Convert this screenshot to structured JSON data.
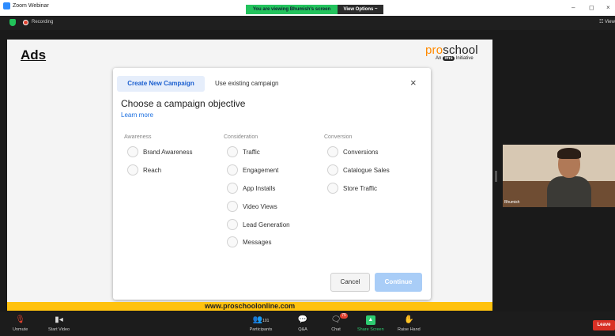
{
  "window": {
    "title": "Zoom Webinar",
    "share_banner": "You are viewing Bhumish's screen",
    "view_options": "View Options ~",
    "minimize": "–",
    "restore": "◻",
    "close": "×"
  },
  "meeting": {
    "recording_label": "Recording",
    "view_label": "☷ View"
  },
  "slide": {
    "title": "Ads",
    "brand_pro": "pro",
    "brand_rest": "school",
    "brand_sub_prefix": "An",
    "brand_sub_logo": "ims",
    "brand_sub_suffix": "Initiative",
    "footer_url": "www.proschoolonline.com"
  },
  "modal": {
    "tab_active": "Create New Campaign",
    "tab_other": "Use existing campaign",
    "close_glyph": "×",
    "heading": "Choose a campaign objective",
    "learn_more": "Learn more",
    "columns": [
      {
        "header": "Awareness",
        "options": [
          "Brand Awareness",
          "Reach"
        ]
      },
      {
        "header": "Consideration",
        "options": [
          "Traffic",
          "Engagement",
          "App Installs",
          "Video Views",
          "Lead Generation",
          "Messages"
        ]
      },
      {
        "header": "Conversion",
        "options": [
          "Conversions",
          "Catalogue Sales",
          "Store Traffic"
        ]
      }
    ],
    "cancel": "Cancel",
    "continue": "Continue"
  },
  "participant": {
    "name": "Bhumish"
  },
  "toolbar": {
    "items": [
      {
        "label": "Unmute",
        "icon": "microphone-muted-icon"
      },
      {
        "label": "Start Video",
        "icon": "video-off-icon"
      },
      {
        "label": "Participants",
        "icon": "participants-icon",
        "count": "101"
      },
      {
        "label": "Q&A",
        "icon": "qa-icon"
      },
      {
        "label": "Chat",
        "icon": "chat-icon",
        "badge": "75"
      },
      {
        "label": "Share Screen",
        "icon": "share-screen-icon"
      },
      {
        "label": "Raise Hand",
        "icon": "raise-hand-icon"
      }
    ],
    "leave": "Leave"
  },
  "colors": {
    "brand_orange": "#ff8a00",
    "share_green": "#23c35d",
    "leave_red": "#d93025",
    "url_bar_yellow": "#ffc20e",
    "link_blue": "#1b6fe0"
  }
}
